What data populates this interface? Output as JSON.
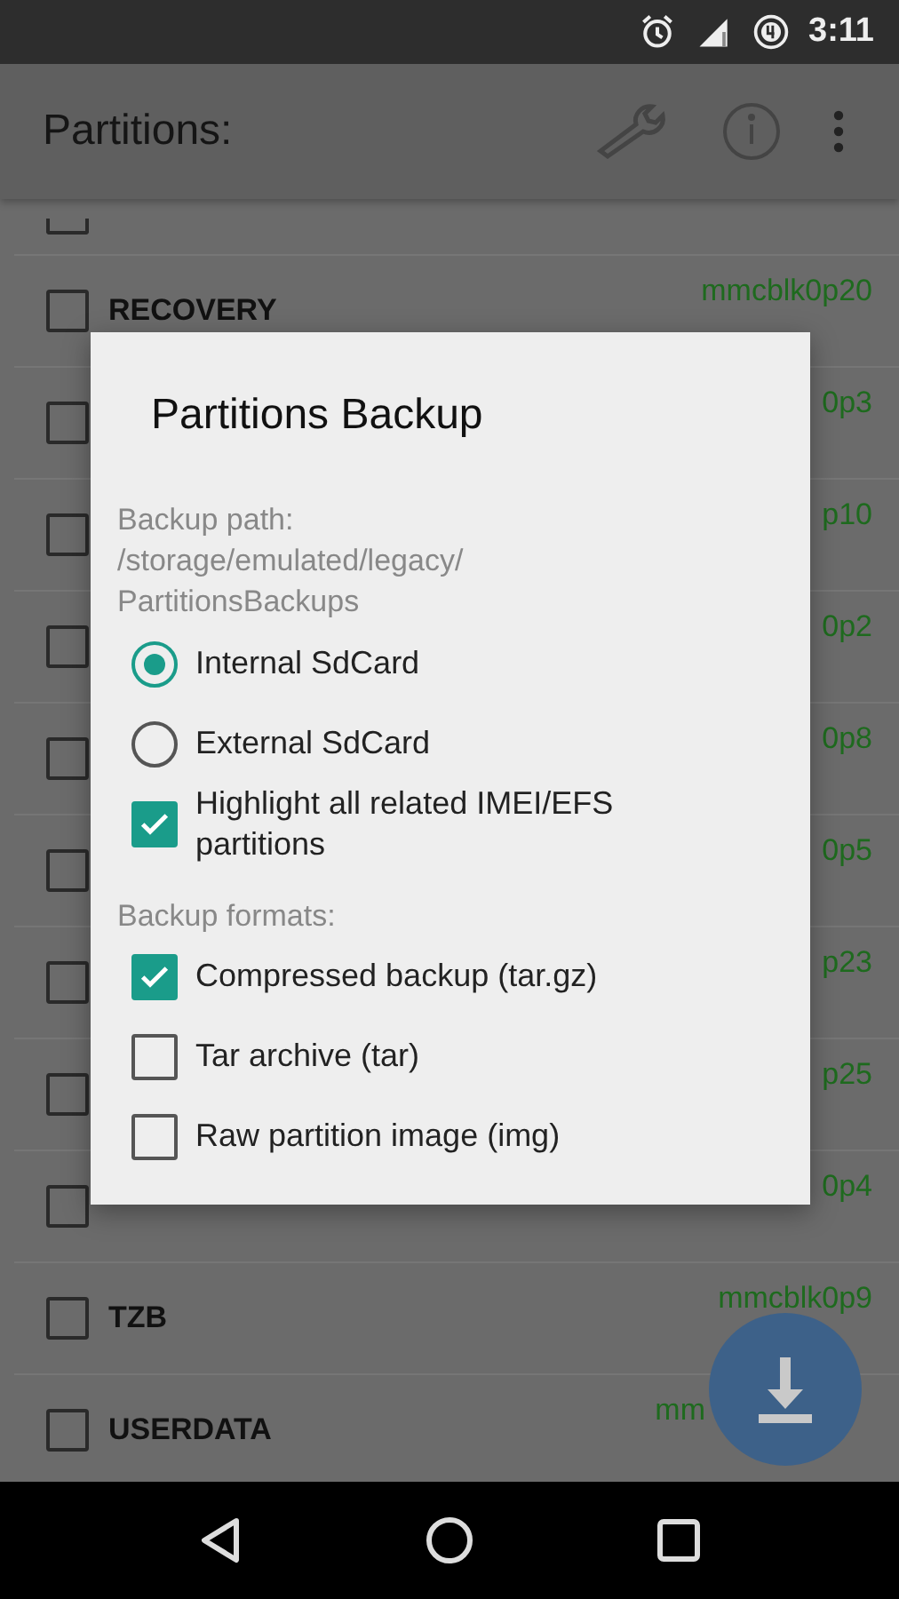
{
  "status_bar": {
    "time": "3:11"
  },
  "app_bar": {
    "title": "Partitions:"
  },
  "partitions": [
    {
      "kind": "cut",
      "checked": false
    },
    {
      "name": "RECOVERY",
      "device": "mmcblk0p20",
      "checked": false
    },
    {
      "device": "0p3",
      "checked": false
    },
    {
      "device": "p10",
      "checked": false
    },
    {
      "device": "0p2",
      "checked": false
    },
    {
      "device": "0p8",
      "checked": false
    },
    {
      "device": "0p5",
      "checked": false
    },
    {
      "device": "p23",
      "checked": false
    },
    {
      "device": "p25",
      "checked": false
    },
    {
      "device": "0p4",
      "checked": false
    },
    {
      "name": "TZB",
      "device": "mmcblk0p9",
      "checked": false
    },
    {
      "name": "USERDATA",
      "device": "mm",
      "checked": false
    }
  ],
  "dialog": {
    "title": "Partitions Backup",
    "path_label": "Backup path:\n/storage/emulated/legacy/\nPartitionsBackups",
    "options": [
      {
        "kind": "radio",
        "label": "Internal SdCard",
        "selected": true
      },
      {
        "kind": "radio",
        "label": "External SdCard",
        "selected": false
      },
      {
        "kind": "checkbox",
        "label": "Highlight all related IMEI/EFS partitions",
        "checked": true
      }
    ],
    "formats_label": "Backup formats:",
    "formats": [
      {
        "label": "Compressed backup (tar.gz)",
        "checked": true
      },
      {
        "label": "Tar archive (tar)",
        "checked": false
      },
      {
        "label": "Raw partition image (img)",
        "checked": false
      }
    ]
  }
}
